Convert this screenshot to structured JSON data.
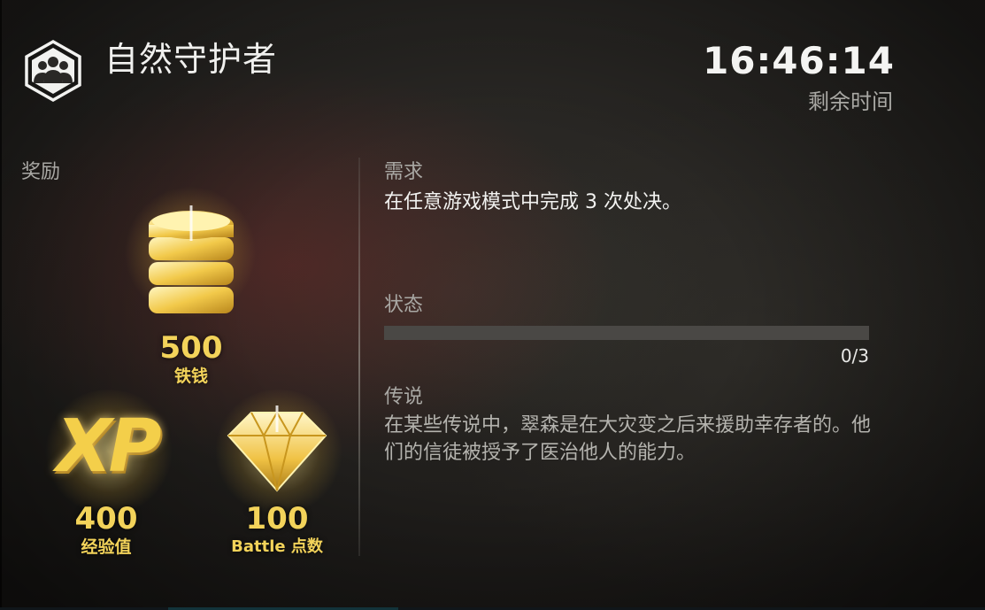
{
  "header": {
    "title": "自然守护者",
    "emblem_icon": "group-shield-icon",
    "timer": "16:46:14",
    "timer_label": "剩余时间"
  },
  "rewards": {
    "label": "奖励",
    "items": [
      {
        "icon": "coin-stack-icon",
        "amount": "500",
        "unit": "铁钱"
      },
      {
        "icon": "xp-icon",
        "icon_text": "XP",
        "amount": "400",
        "unit": "经验值"
      },
      {
        "icon": "diamond-icon",
        "amount": "100",
        "unit": "Battle 点数"
      }
    ]
  },
  "requirement": {
    "label": "需求",
    "text": "在任意游戏模式中完成 3 次处决。"
  },
  "status": {
    "label": "状态",
    "progress_current": 0,
    "progress_total": 3,
    "progress_text": "0/3"
  },
  "lore": {
    "label": "传说",
    "text": "在某些传说中，翠森是在大灾变之后来援助幸存者的。他们的信徒被授予了医治他人的能力。"
  },
  "colors": {
    "reward_gold": "#f3d35a",
    "title_white": "#f0f0ee",
    "label_gray": "#a9a8a4",
    "progress_track": "#4a4845"
  }
}
